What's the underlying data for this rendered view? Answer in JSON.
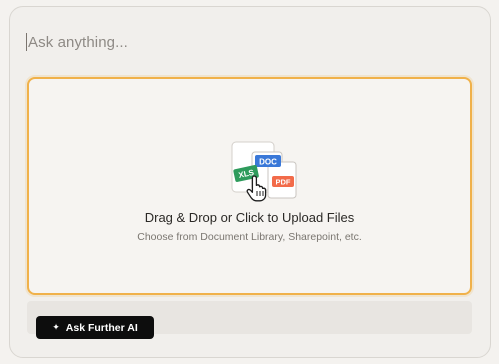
{
  "prompt": {
    "placeholder": "Ask anything..."
  },
  "dropzone": {
    "title": "Drag & Drop or Click to Upload Files",
    "subtitle": "Choose from Document Library, Sharepoint, etc.",
    "file_badges": {
      "xls": "XLS",
      "doc": "DOC",
      "pdf": "PDF"
    }
  },
  "actions": {
    "ask_label": "Ask Further AI",
    "ask_icon": "sparkle-icon"
  },
  "colors": {
    "accent_border": "#f0b14a",
    "button_bg": "#0d0d0d",
    "xls": "#2e9b5c",
    "doc": "#3a78d8",
    "pdf": "#f26b4a"
  }
}
